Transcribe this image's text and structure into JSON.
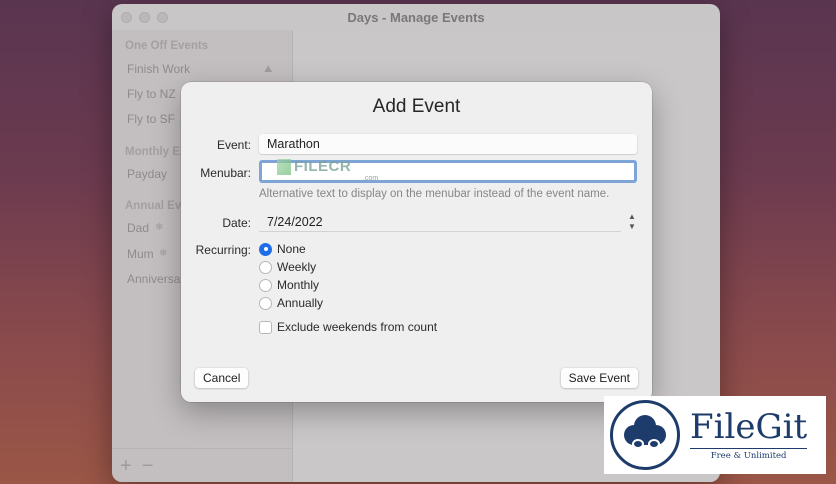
{
  "window": {
    "title": "Days - Manage Events"
  },
  "sidebar": {
    "sections": [
      {
        "heading": "One Off Events",
        "items": [
          "Finish Work",
          "Fly to NZ",
          "Fly to SF"
        ]
      },
      {
        "heading": "Monthly E",
        "items": [
          "Payday"
        ]
      },
      {
        "heading": "Annual Ev",
        "items": [
          "Dad",
          "Mum",
          "Anniversa"
        ]
      }
    ],
    "add_label": "+",
    "remove_label": "−"
  },
  "dialog": {
    "title": "Add Event",
    "event_label": "Event:",
    "event_value": "Marathon",
    "menubar_label": "Menubar:",
    "menubar_value": "",
    "menubar_help": "Alternative text to display on the menubar instead of the event name.",
    "date_label": "Date:",
    "date_value": "7/24/2022",
    "recurring_label": "Recurring:",
    "recurring_options": [
      "None",
      "Weekly",
      "Monthly",
      "Annually"
    ],
    "recurring_selected": "None",
    "exclude_weekends_label": "Exclude weekends from count",
    "exclude_weekends_checked": false,
    "cancel_label": "Cancel",
    "save_label": "Save Event"
  },
  "watermarks": {
    "filecr_text": "FILECR",
    "filecr_domain": ".com",
    "filegit_name": "FileGit",
    "filegit_tagline": "Free & Unlimited"
  },
  "colors": {
    "accent": "#1f6ee8",
    "focus_ring": "#7fa4d8"
  }
}
